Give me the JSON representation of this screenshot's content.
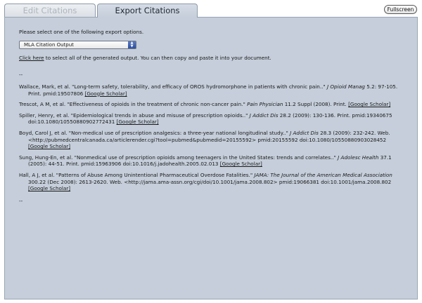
{
  "tabs": {
    "edit": "Edit Citations",
    "export": "Export Citations"
  },
  "fullscreen_label": "Fullscreen",
  "instruction": "Please select one of the following export options.",
  "export_select": {
    "value": "MLA Citation Output"
  },
  "select_hint": {
    "link": "Click here",
    "rest": " to select all of the generated output. You can then copy and paste it into your document."
  },
  "separator_top": "--",
  "separator_bottom": "--",
  "citations": [
    {
      "pre": "Wallace, Mark, et al. \"Long-term safety, tolerability, and efficacy of OROS hydromorphone in patients with chronic pain..\" ",
      "journal": "J Opioid Manag",
      "post": " 5.2: 97-105. Print. pmid:19507806 ",
      "link": "[Google Scholar]"
    },
    {
      "pre": "Trescot, A M, et al. \"Effectiveness of opioids in the treatment of chronic non-cancer pain.\" ",
      "journal": "Pain Physician",
      "post": " 11.2 Suppl (2008). Print. ",
      "link": "[Google Scholar]"
    },
    {
      "pre": "Spiller, Henry, et al. \"Epidemiological trends in abuse and misuse of prescription opioids..\" ",
      "journal": "J Addict Dis",
      "post": " 28.2 (2009): 130-136. Print. pmid:19340675 doi:10.1080/10550880902772431 ",
      "link": "[Google Scholar]"
    },
    {
      "pre": "Boyd, Carol J, et al. \"Non-medical use of prescription analgesics: a three-year national longitudinal study..\" ",
      "journal": "J Addict Dis",
      "post": " 28.3 (2009): 232-242. Web. <http://pubmedcentralcanada.ca/articlerender.cgi?tool=pubmed&pubmedid=20155592> pmid:20155592 doi:10.1080/10550880903028452 ",
      "link": "[Google Scholar]"
    },
    {
      "pre": "Sung, Hung-En, et al. \"Nonmedical use of prescription opioids among teenagers in the United States: trends and correlates..\" ",
      "journal": "J Adolesc Health",
      "post": " 37.1 (2005): 44-51. Print. pmid:15963906 doi:10.1016/j.jadohealth.2005.02.013 ",
      "link": "[Google Scholar]"
    },
    {
      "pre": "Hall, A J, et al. \"Patterns of Abuse Among Unintentional Pharmaceutical Overdose Fatalities.\" ",
      "journal": "JAMA: The Journal of the American Medical Association",
      "post": " 300.22 (Dec 2008): 2613-2620. Web. <http://jama.ama-assn.org/cgi/doi/10.1001/jama.2008.802> pmid:19066381 doi:10.1001/jama.2008.802 ",
      "link": "[Google Scholar]"
    }
  ]
}
